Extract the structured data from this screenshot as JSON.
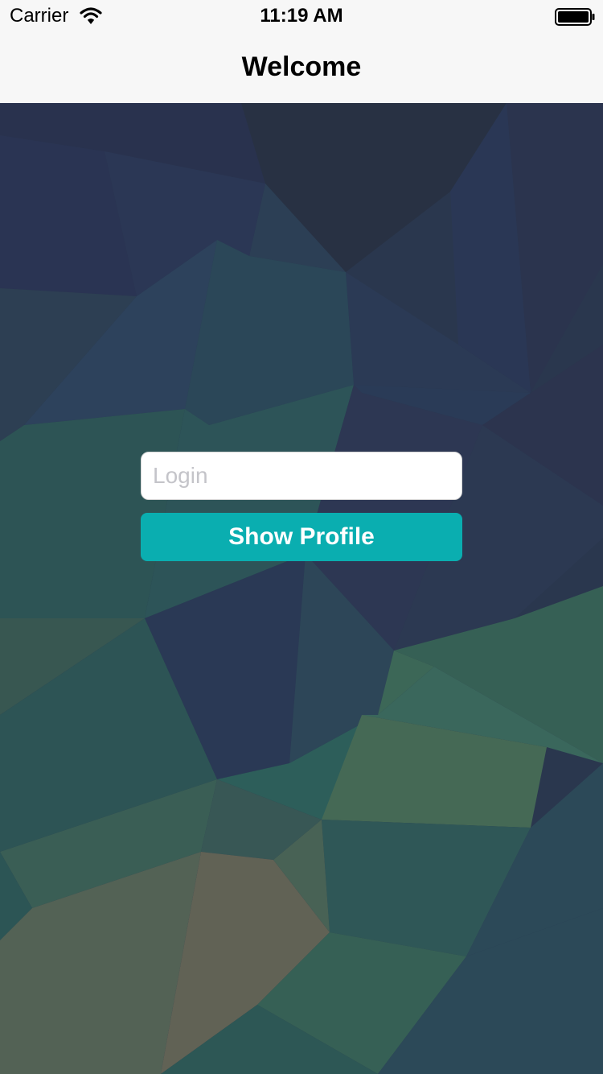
{
  "status_bar": {
    "carrier": "Carrier",
    "time": "11:19 AM",
    "wifi_icon": "wifi-icon",
    "battery_icon": "battery-icon"
  },
  "nav_bar": {
    "title": "Welcome"
  },
  "login_form": {
    "login_value": "",
    "login_placeholder": "Login",
    "show_profile_label": "Show Profile"
  },
  "colors": {
    "nav_background": "#f7f7f7",
    "button_background": "#0aaeb0",
    "button_text": "#ffffff",
    "input_background": "#ffffff",
    "placeholder": "#c4c4c9"
  }
}
